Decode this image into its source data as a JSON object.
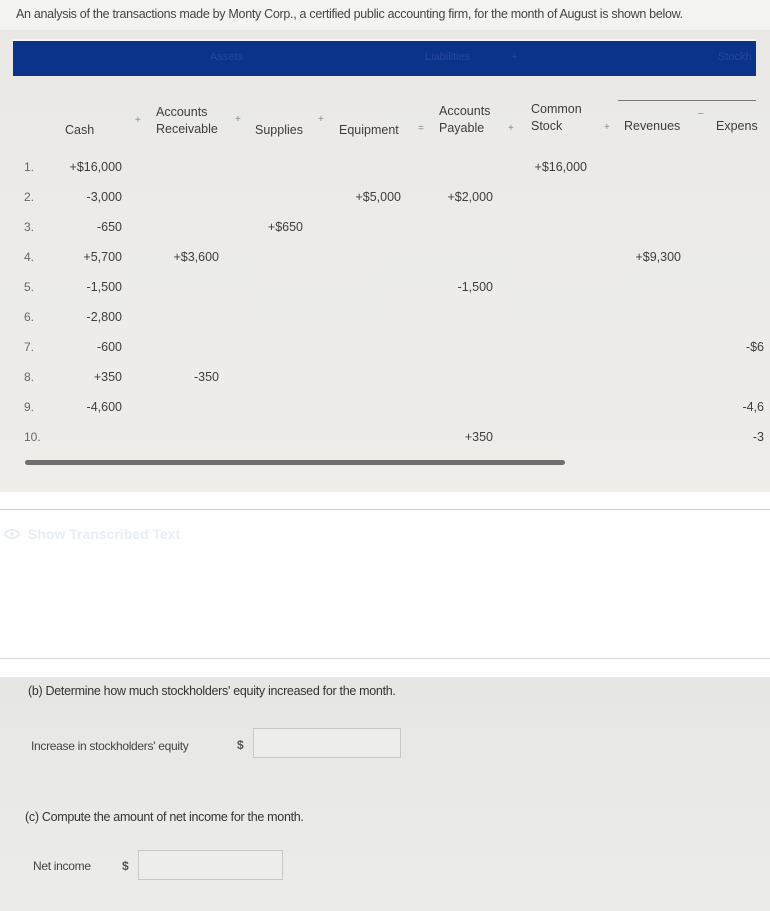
{
  "intro_text": "An analysis of the transactions made by Monty Corp., a certified public accounting firm, for the month of August is shown below.",
  "table": {
    "band_labels": {
      "assets": "Assets",
      "liabilities": "Liabilities",
      "stockholders_equity": "Stockh"
    },
    "columns": {
      "cash": "Cash",
      "accounts_receivable_1": "Accounts",
      "accounts_receivable_2": "Receivable",
      "supplies": "Supplies",
      "equipment": "Equipment",
      "accounts_payable_1": "Accounts",
      "accounts_payable_2": "Payable",
      "common_stock_1": "Common",
      "common_stock_2": "Stock",
      "revenues": "Revenues",
      "expenses": "Expens"
    },
    "operators": {
      "plus": "+",
      "equals": "=",
      "minus": "–"
    },
    "rows": [
      {
        "num": "1.",
        "cash": "+$16,000",
        "ar": "",
        "supplies": "",
        "equipment": "",
        "ap": "",
        "cs": "+$16,000",
        "rev": "",
        "exp": ""
      },
      {
        "num": "2.",
        "cash": "-3,000",
        "ar": "",
        "supplies": "",
        "equipment": "+$5,000",
        "ap": "+$2,000",
        "cs": "",
        "rev": "",
        "exp": ""
      },
      {
        "num": "3.",
        "cash": "-650",
        "ar": "",
        "supplies": "+$650",
        "equipment": "",
        "ap": "",
        "cs": "",
        "rev": "",
        "exp": ""
      },
      {
        "num": "4.",
        "cash": "+5,700",
        "ar": "+$3,600",
        "supplies": "",
        "equipment": "",
        "ap": "",
        "cs": "",
        "rev": "+$9,300",
        "exp": ""
      },
      {
        "num": "5.",
        "cash": "-1,500",
        "ar": "",
        "supplies": "",
        "equipment": "",
        "ap": "-1,500",
        "cs": "",
        "rev": "",
        "exp": ""
      },
      {
        "num": "6.",
        "cash": "-2,800",
        "ar": "",
        "supplies": "",
        "equipment": "",
        "ap": "",
        "cs": "",
        "rev": "",
        "exp": ""
      },
      {
        "num": "7.",
        "cash": "-600",
        "ar": "",
        "supplies": "",
        "equipment": "",
        "ap": "",
        "cs": "",
        "rev": "",
        "exp": "-$6"
      },
      {
        "num": "8.",
        "cash": "+350",
        "ar": "-350",
        "supplies": "",
        "equipment": "",
        "ap": "",
        "cs": "",
        "rev": "",
        "exp": ""
      },
      {
        "num": "9.",
        "cash": "-4,600",
        "ar": "",
        "supplies": "",
        "equipment": "",
        "ap": "",
        "cs": "",
        "rev": "",
        "exp": "-4,6"
      },
      {
        "num": "10.",
        "cash": "",
        "ar": "",
        "supplies": "",
        "equipment": "",
        "ap": "+350",
        "cs": "",
        "rev": "",
        "exp": "-3"
      }
    ]
  },
  "show_transcribed_text": "Show Transcribed Text",
  "part_b": {
    "question": "(b) Determine how much stockholders' equity increased for the month.",
    "label": "Increase in stockholders' equity",
    "currency": "$",
    "value": ""
  },
  "part_c": {
    "question": "(c) Compute the amount of net income for the month.",
    "label": "Net income",
    "currency": "$",
    "value": ""
  }
}
